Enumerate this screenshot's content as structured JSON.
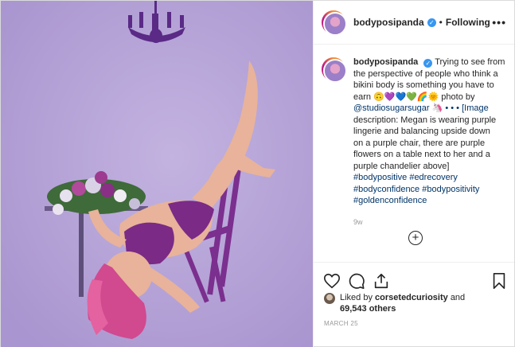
{
  "post": {
    "username": "bodyposipanda",
    "separator": "•",
    "follow_label": "Following",
    "more_label": "•••",
    "caption": {
      "username": "bodyposipanda",
      "lines": [
        "Trying to see from",
        "the perspective of people who think a",
        "bikini body is something you have to",
        "earn 🙃💜💙💚🌈🌞 photo by",
        "@studiosugarsugar 🦄 • • • [Image",
        "description: Megan is wearing purple",
        "lingerie and balancing upside down",
        "on a purple chair, there are purple",
        "flowers on a table next to her and a",
        "purple chandelier above]"
      ],
      "hashtags": [
        "#bodypositive #edrecovery",
        "#bodyconfidence #bodypositivity",
        "#goldenconfidence"
      ],
      "age": "9w"
    },
    "load_more": "+",
    "actions": {
      "like": "heart-icon",
      "comment": "comment-icon",
      "share": "share-icon",
      "save": "bookmark-icon"
    },
    "likes": {
      "prefix": "Liked by",
      "liker": "corsetedcuriosity",
      "conjunction": "and",
      "count": "69,543 others"
    },
    "date": "MARCH 25"
  },
  "colors": {
    "background_purple": "#b7a6d6",
    "verified_blue": "#3897f0",
    "hashtag_blue": "#003569",
    "lingerie_purple": "#7b2a86"
  }
}
